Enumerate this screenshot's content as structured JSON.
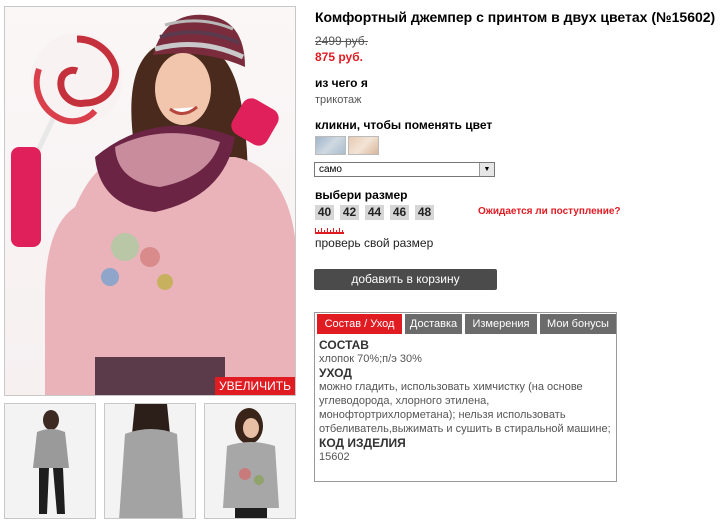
{
  "product": {
    "title": "Комфортный джемпер с принтом в двух цветах (№15602)",
    "old_price": "2499 руб.",
    "new_price": "875 руб."
  },
  "material": {
    "label": "из чего я",
    "value": "трикотаж"
  },
  "color": {
    "label": "кликни, чтобы поменять цвет",
    "swatches": [
      "swatch-1",
      "swatch-2"
    ],
    "selected_value": "само"
  },
  "size": {
    "label": "выбери размер",
    "options": [
      "40",
      "42",
      "44",
      "46",
      "48"
    ],
    "notify_link": "Ожидается ли поступление?",
    "check_link": "проверь свой размер"
  },
  "cart": {
    "button_label": "добавить в корзину"
  },
  "gallery": {
    "zoom_label": "УВЕЛИЧИТЬ"
  },
  "tabs": [
    {
      "label": "Состав / Уход"
    },
    {
      "label": "Доставка"
    },
    {
      "label": "Измерения"
    },
    {
      "label": "Мои бонусы"
    }
  ],
  "details": {
    "composition_heading": "СОСТАВ",
    "composition_value": "хлопок 70%;п/э 30%",
    "care_heading": "УХОД",
    "care_value": "можно гладить, использовать химчистку (на основе углеводорода, хлорного этилена, монофтортрихлорметана); нельзя использовать отбеливатель,выжимать и сушить в стиральной машине;",
    "code_heading": "КОД ИЗДЕЛИЯ",
    "code_value": "15602"
  },
  "colors": {
    "accent_red": "#e11b22",
    "tab_gray": "#6b6b6b",
    "button_dark": "#4b4b4b",
    "size_bg": "#d6d6d6"
  }
}
